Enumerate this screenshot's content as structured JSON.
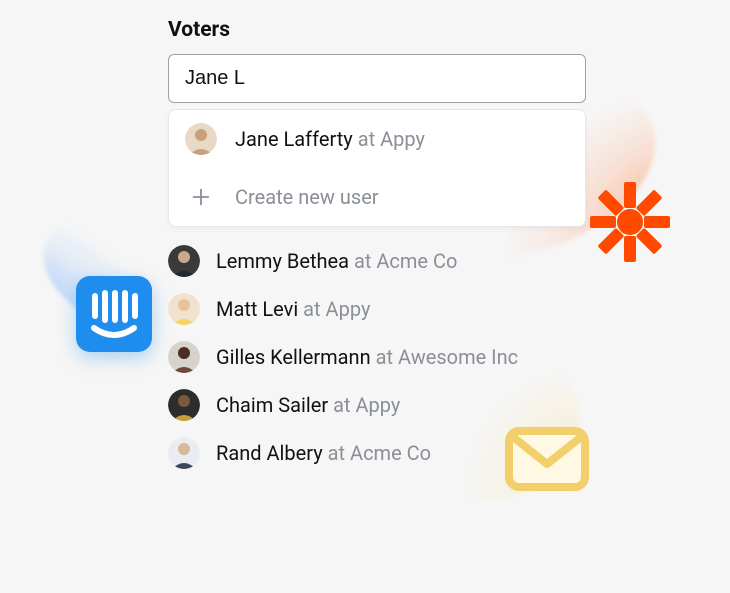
{
  "heading": "Voters",
  "search": {
    "value": "Jane L"
  },
  "dropdown": {
    "match": {
      "name": "Jane Lafferty",
      "at": "at",
      "org": "Appy"
    },
    "create_label": "Create new user"
  },
  "voters": [
    {
      "name": "Lemmy Bethea",
      "at": "at",
      "org": "Acme Co"
    },
    {
      "name": "Matt Levi",
      "at": "at",
      "org": "Appy"
    },
    {
      "name": "Gilles Kellermann",
      "at": "at",
      "org": "Awesome Inc"
    },
    {
      "name": "Chaim Sailer",
      "at": "at",
      "org": "Appy"
    },
    {
      "name": "Rand Albery",
      "at": "at",
      "org": "Acme Co"
    }
  ],
  "integrations": {
    "intercom": "Intercom",
    "zapier": "Zapier",
    "mail": "Email"
  },
  "colors": {
    "zapier": "#ff4a00",
    "intercom": "#1f8ded",
    "mail_border": "#f2cf6a",
    "mail_fill": "#fff8e3"
  }
}
